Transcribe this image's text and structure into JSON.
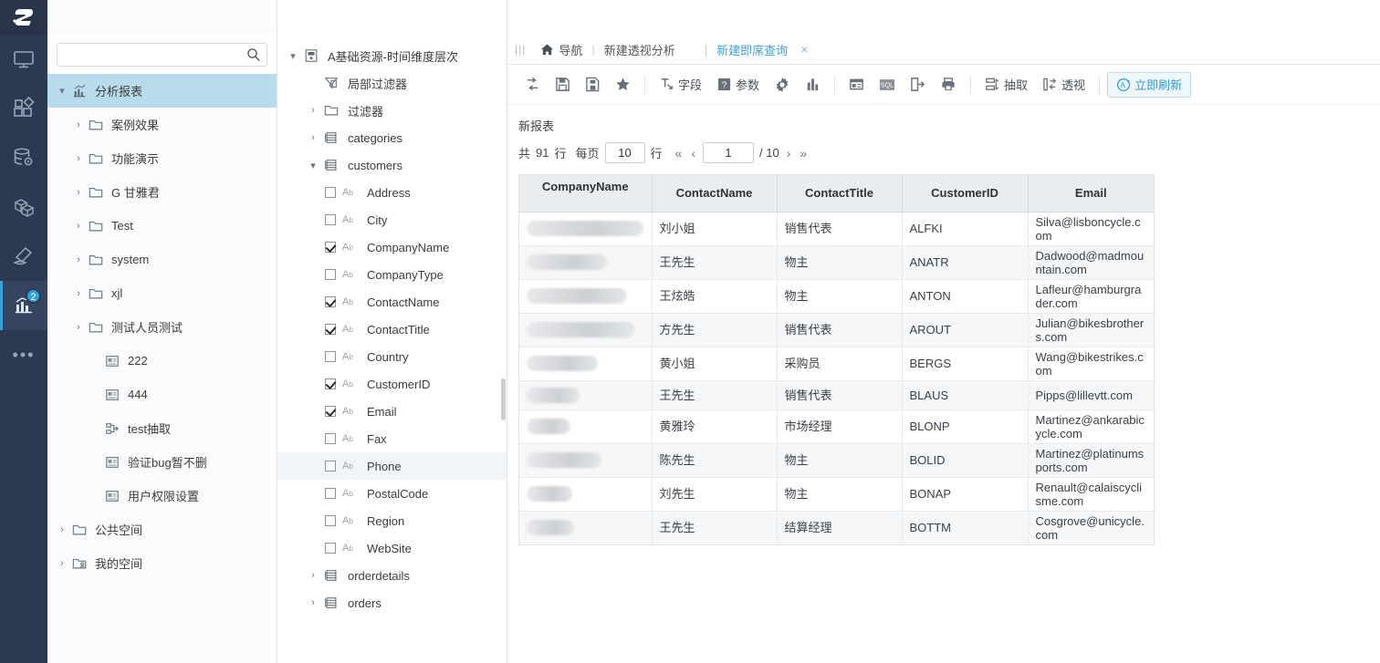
{
  "brand": {
    "logo_text": "S",
    "topbar_color": "#2389bf",
    "rail_color": "#2b3a52",
    "accent": "#3ba3dd"
  },
  "rail": {
    "items": [
      {
        "name": "monitor-icon",
        "label": "监控",
        "badge": ""
      },
      {
        "name": "blocks-icon",
        "label": "应用",
        "badge": ""
      },
      {
        "name": "database-gear-icon",
        "label": "数据",
        "badge": ""
      },
      {
        "name": "cube-icon",
        "label": "模型",
        "badge": ""
      },
      {
        "name": "hammer-icon",
        "label": "工具",
        "badge": ""
      },
      {
        "name": "chart-icon",
        "label": "分析报表",
        "badge": "2"
      },
      {
        "name": "more-icon",
        "label": "更多",
        "badge": ""
      }
    ]
  },
  "search": {
    "value": "",
    "placeholder": ""
  },
  "sidebar": {
    "items": [
      {
        "label": "分析报表",
        "icon": "chart-icon",
        "level": 0,
        "caret": "down",
        "selected": true
      },
      {
        "label": "案例效果",
        "icon": "folder-icon",
        "level": 1,
        "caret": "right",
        "selected": false
      },
      {
        "label": "功能演示",
        "icon": "folder-icon",
        "level": 1,
        "caret": "right",
        "selected": false
      },
      {
        "label": "G 甘雅君",
        "icon": "folder-icon",
        "level": 1,
        "caret": "right",
        "selected": false
      },
      {
        "label": "Test",
        "icon": "folder-icon",
        "level": 1,
        "caret": "right",
        "selected": false
      },
      {
        "label": "system",
        "icon": "folder-icon",
        "level": 1,
        "caret": "right",
        "selected": false
      },
      {
        "label": "xjl",
        "icon": "folder-icon",
        "level": 1,
        "caret": "right",
        "selected": false
      },
      {
        "label": "测试人员测试",
        "icon": "folder-icon",
        "level": 1,
        "caret": "right",
        "selected": false
      },
      {
        "label": "222",
        "icon": "report-icon",
        "level": 2,
        "caret": "",
        "selected": false
      },
      {
        "label": "444",
        "icon": "report-icon",
        "level": 2,
        "caret": "",
        "selected": false
      },
      {
        "label": "test抽取",
        "icon": "extract-icon",
        "level": 2,
        "caret": "",
        "selected": false
      },
      {
        "label": "验证bug暂不删",
        "icon": "report-icon",
        "level": 2,
        "caret": "",
        "selected": false
      },
      {
        "label": "用户权限设置",
        "icon": "report-icon",
        "level": 2,
        "caret": "",
        "selected": false
      },
      {
        "label": "公共空间",
        "icon": "folder-icon",
        "level": 0,
        "caret": "right",
        "selected": false
      },
      {
        "label": "我的空间",
        "icon": "my-folder-icon",
        "level": 0,
        "caret": "right",
        "selected": false
      }
    ]
  },
  "fieldtree": {
    "items": [
      {
        "label": "A基础资源-时间维度层次",
        "icon": "dataset-icon",
        "level": 0,
        "caret": "down",
        "checkbox": "",
        "highlight": false
      },
      {
        "label": "局部过滤器",
        "icon": "local-filter-icon",
        "level": 1,
        "caret": "",
        "checkbox": "",
        "highlight": false
      },
      {
        "label": "过滤器",
        "icon": "folder-icon",
        "level": 1,
        "caret": "right",
        "checkbox": "",
        "highlight": false
      },
      {
        "label": "categories",
        "icon": "table-icon",
        "level": 1,
        "caret": "right",
        "checkbox": "",
        "highlight": false
      },
      {
        "label": "customers",
        "icon": "table-icon",
        "level": 1,
        "caret": "down",
        "checkbox": "",
        "highlight": false
      },
      {
        "label": "Address",
        "icon": "text-field-icon",
        "level": 2,
        "caret": "",
        "checkbox": "off",
        "highlight": false
      },
      {
        "label": "City",
        "icon": "text-field-icon",
        "level": 2,
        "caret": "",
        "checkbox": "off",
        "highlight": false
      },
      {
        "label": "CompanyName",
        "icon": "text-field-icon",
        "level": 2,
        "caret": "",
        "checkbox": "on",
        "highlight": false
      },
      {
        "label": "CompanyType",
        "icon": "text-field-icon",
        "level": 2,
        "caret": "",
        "checkbox": "off",
        "highlight": false
      },
      {
        "label": "ContactName",
        "icon": "text-field-icon",
        "level": 2,
        "caret": "",
        "checkbox": "on",
        "highlight": false
      },
      {
        "label": "ContactTitle",
        "icon": "text-field-icon",
        "level": 2,
        "caret": "",
        "checkbox": "on",
        "highlight": false
      },
      {
        "label": "Country",
        "icon": "text-field-icon",
        "level": 2,
        "caret": "",
        "checkbox": "off",
        "highlight": false
      },
      {
        "label": "CustomerID",
        "icon": "text-field-icon",
        "level": 2,
        "caret": "",
        "checkbox": "on",
        "highlight": false
      },
      {
        "label": "Email",
        "icon": "text-field-icon",
        "level": 2,
        "caret": "",
        "checkbox": "on",
        "highlight": false
      },
      {
        "label": "Fax",
        "icon": "text-field-icon",
        "level": 2,
        "caret": "",
        "checkbox": "off",
        "highlight": false
      },
      {
        "label": "Phone",
        "icon": "text-field-icon",
        "level": 2,
        "caret": "",
        "checkbox": "off",
        "highlight": true
      },
      {
        "label": "PostalCode",
        "icon": "text-field-icon",
        "level": 2,
        "caret": "",
        "checkbox": "off",
        "highlight": false
      },
      {
        "label": "Region",
        "icon": "text-field-icon",
        "level": 2,
        "caret": "",
        "checkbox": "off",
        "highlight": false
      },
      {
        "label": "WebSite",
        "icon": "text-field-icon",
        "level": 2,
        "caret": "",
        "checkbox": "off",
        "highlight": false
      },
      {
        "label": "orderdetails",
        "icon": "table-icon",
        "level": 1,
        "caret": "right",
        "checkbox": "",
        "highlight": false
      },
      {
        "label": "orders",
        "icon": "table-icon",
        "level": 1,
        "caret": "right",
        "checkbox": "",
        "highlight": false
      }
    ]
  },
  "breadcrumb": {
    "handle": "|||",
    "home_label": "导航",
    "sep": "|",
    "items": [
      {
        "label": "新建透视分析",
        "active": false
      },
      {
        "label": "新建即席查询",
        "active": true
      }
    ],
    "close": "×"
  },
  "toolbar": {
    "buttons": [
      {
        "name": "reset-button",
        "icon": "swap-icon",
        "label": ""
      },
      {
        "name": "save-button",
        "icon": "save-icon",
        "label": ""
      },
      {
        "name": "save-as-button",
        "icon": "save-as-icon",
        "label": ""
      },
      {
        "name": "favorite-button",
        "icon": "star-icon",
        "label": ""
      },
      {
        "name": "field-button",
        "icon": "field-icon",
        "label": "字段"
      },
      {
        "name": "parameter-button",
        "icon": "question-icon",
        "label": "参数"
      },
      {
        "name": "settings-button",
        "icon": "gear-icon",
        "label": ""
      },
      {
        "name": "chart-button",
        "icon": "bar-chart-icon",
        "label": ""
      },
      {
        "name": "layout-button",
        "icon": "layout-icon",
        "label": ""
      },
      {
        "name": "sql-button",
        "icon": "sql-icon",
        "label": ""
      },
      {
        "name": "export-button",
        "icon": "export-icon",
        "label": ""
      },
      {
        "name": "print-button",
        "icon": "printer-icon",
        "label": ""
      },
      {
        "name": "extract-button",
        "icon": "extract-icon",
        "label": "抽取"
      },
      {
        "name": "pivot-button",
        "icon": "pivot-icon",
        "label": "透视"
      },
      {
        "name": "refresh-now-button",
        "icon": "auto-refresh-icon",
        "label": "立即刷新"
      }
    ]
  },
  "report": {
    "title": "新报表",
    "pager": {
      "total_prefix": "共",
      "total": "91",
      "total_suffix": "行",
      "per_page_label": "每页",
      "per_page_value": "10",
      "per_page_suffix": "行",
      "first": "«",
      "prev": "‹",
      "page_value": "1",
      "page_total": "/ 10",
      "next": "›",
      "last": "»"
    }
  },
  "table": {
    "columns": [
      "CompanyName",
      "ContactName",
      "ContactTitle",
      "CustomerID",
      "Email"
    ],
    "rows": [
      {
        "CompanyName": "",
        "redacted": true,
        "ContactName": "刘小姐",
        "ContactTitle": "销售代表",
        "CustomerID": "ALFKI",
        "Email": "Silva@lisboncycle.com"
      },
      {
        "CompanyName": "",
        "redacted": true,
        "ContactName": "王先生",
        "ContactTitle": "物主",
        "CustomerID": "ANATR",
        "Email": "Dadwood@madmountain.com"
      },
      {
        "CompanyName": "",
        "redacted": true,
        "ContactName": "王炫皓",
        "ContactTitle": "物主",
        "CustomerID": "ANTON",
        "Email": "Lafleur@hamburgrader.com"
      },
      {
        "CompanyName": "",
        "redacted": true,
        "ContactName": "方先生",
        "ContactTitle": "销售代表",
        "CustomerID": "AROUT",
        "Email": "Julian@bikesbrothers.com"
      },
      {
        "CompanyName": "",
        "redacted": true,
        "ContactName": "黄小姐",
        "ContactTitle": "采购员",
        "CustomerID": "BERGS",
        "Email": "Wang@bikestrikes.com"
      },
      {
        "CompanyName": "",
        "redacted": true,
        "ContactName": "王先生",
        "ContactTitle": "销售代表",
        "CustomerID": "BLAUS",
        "Email": "Pipps@lillevtt.com"
      },
      {
        "CompanyName": "",
        "redacted": true,
        "ContactName": "黄雅玲",
        "ContactTitle": "市场经理",
        "CustomerID": "BLONP",
        "Email": "Martinez@ankarabicycle.com"
      },
      {
        "CompanyName": "",
        "redacted": true,
        "ContactName": "陈先生",
        "ContactTitle": "物主",
        "CustomerID": "BOLID",
        "Email": "Martinez@platinumsports.com"
      },
      {
        "CompanyName": "",
        "redacted": true,
        "ContactName": "刘先生",
        "ContactTitle": "物主",
        "CustomerID": "BONAP",
        "Email": "Renault@calaiscyclisme.com"
      },
      {
        "CompanyName": "",
        "redacted": true,
        "ContactName": "王先生",
        "ContactTitle": "结算经理",
        "CustomerID": "BOTTM",
        "Email": "Cosgrove@unicycle.com"
      }
    ],
    "redact_widths": [
      128,
      88,
      110,
      118,
      78,
      58,
      48,
      82,
      50,
      52
    ]
  }
}
